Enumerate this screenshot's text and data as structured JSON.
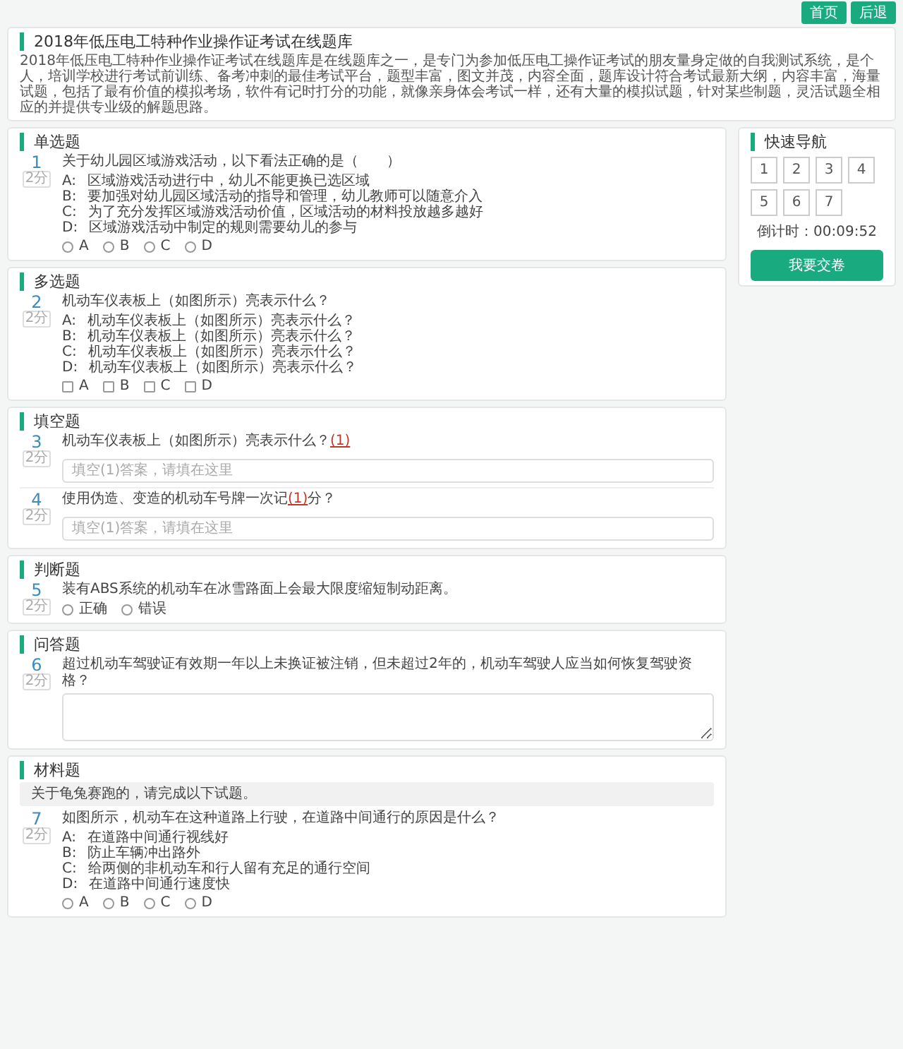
{
  "top_buttons": [
    {
      "label": "首页"
    },
    {
      "label": "后退"
    }
  ],
  "exam": {
    "title": "2018年低压电工特种作业操作证考试在线题库",
    "intro": "2018年低压电工特种作业操作证考试在线题库是在线题库之一，是专门为参加低压电工操作证考试的朋友量身定做的自我测试系统，是个人，培训学校进行考试前训练、备考冲刺的最佳考试平台，题型丰富，图文并茂，内容全面，题库设计符合考试最新大纲，内容丰富，海量试题，包括了最有价值的模拟考场，软件有记时打分的功能，就像亲身体会考试一样，还有大量的模拟试题，针对某些制题，灵活试题全相应的并提供专业级的解题思路。"
  },
  "sections": [
    {
      "kind": "single",
      "title": "单选题",
      "questions": [
        {
          "number": "1",
          "score": "2分",
          "text": "关于幼儿园区域游戏活动，以下看法正确的是（　　）",
          "options": [
            {
              "letter": "A:",
              "text": "区域游戏活动进行中，幼儿不能更换已选区域"
            },
            {
              "letter": "B:",
              "text": "要加强对幼儿园区域活动的指导和管理，幼儿教师可以随意介入"
            },
            {
              "letter": "C:",
              "text": "为了充分发挥区域游戏活动价值，区域活动的材料投放越多越好"
            },
            {
              "letter": "D:",
              "text": "区域游戏活动中制定的规则需要幼儿的参与"
            }
          ],
          "choices": [
            {
              "label": "A",
              "selected": false
            },
            {
              "label": "B",
              "selected": false
            },
            {
              "label": "C",
              "selected": false
            },
            {
              "label": "D",
              "selected": false
            }
          ]
        }
      ]
    },
    {
      "kind": "multiple",
      "title": "多选题",
      "questions": [
        {
          "number": "2",
          "score": "2分",
          "text": "机动车仪表板上（如图所示）亮表示什么？",
          "options": [
            {
              "letter": "A:",
              "text": "机动车仪表板上（如图所示）亮表示什么？"
            },
            {
              "letter": "B:",
              "text": "机动车仪表板上（如图所示）亮表示什么？"
            },
            {
              "letter": "C:",
              "text": "机动车仪表板上（如图所示）亮表示什么？"
            },
            {
              "letter": "D:",
              "text": "机动车仪表板上（如图所示）亮表示什么？"
            }
          ],
          "choices": [
            {
              "label": "A",
              "checked": false
            },
            {
              "label": "B",
              "checked": false
            },
            {
              "label": "C",
              "checked": false
            },
            {
              "label": "D",
              "checked": false
            }
          ]
        }
      ]
    },
    {
      "kind": "fill",
      "title": "填空题",
      "questions": [
        {
          "number": "3",
          "score": "2分",
          "text": "机动车仪表板上（如图所示）亮表示什么？",
          "blank": "(1)",
          "placeholder": "填空(1)答案，请填在这里"
        },
        {
          "number": "4",
          "score": "2分",
          "text": "使用伪造、变造的机动车号牌一次记",
          "blank": "(1)",
          "text_after": "分？",
          "placeholder": "填空(1)答案，请填在这里"
        }
      ]
    },
    {
      "kind": "judge",
      "title": "判断题",
      "questions": [
        {
          "number": "5",
          "score": "2分",
          "text": "装有ABS系统的机动车在冰雪路面上会最大限度缩短制动距离。",
          "choices": [
            {
              "label": "正确",
              "selected": false
            },
            {
              "label": "错误",
              "selected": false
            }
          ]
        }
      ]
    },
    {
      "kind": "essay",
      "title": "问答题",
      "questions": [
        {
          "number": "6",
          "score": "2分",
          "text": "超过机动车驾驶证有效期一年以上未换证被注销，但未超过2年的，机动车驾驶人应当如何恢复驾驶资格？"
        }
      ]
    },
    {
      "kind": "single",
      "title": "材料题",
      "material": "关于龟兔赛跑的，请完成以下试题。",
      "questions": [
        {
          "number": "7",
          "score": "2分",
          "text": "如图所示，机动车在这种道路上行驶，在道路中间通行的原因是什么？",
          "options": [
            {
              "letter": "A:",
              "text": "在道路中间通行视线好"
            },
            {
              "letter": "B:",
              "text": "防止车辆冲出路外"
            },
            {
              "letter": "C:",
              "text": "给两侧的非机动车和行人留有充足的通行空间"
            },
            {
              "letter": "D:",
              "text": "在道路中间通行速度快"
            }
          ],
          "choices": [
            {
              "label": "A",
              "selected": false
            },
            {
              "label": "B",
              "selected": false
            },
            {
              "label": "C",
              "selected": false
            },
            {
              "label": "D",
              "selected": false
            }
          ]
        }
      ]
    }
  ],
  "nav": {
    "title": "快速导航",
    "items": [
      {
        "label": "1"
      },
      {
        "label": "2"
      },
      {
        "label": "3"
      },
      {
        "label": "4"
      },
      {
        "label": "5"
      },
      {
        "label": "6"
      },
      {
        "label": "7"
      }
    ],
    "countdown": "倒计时：00:09:52",
    "submit": "我要交卷"
  }
}
